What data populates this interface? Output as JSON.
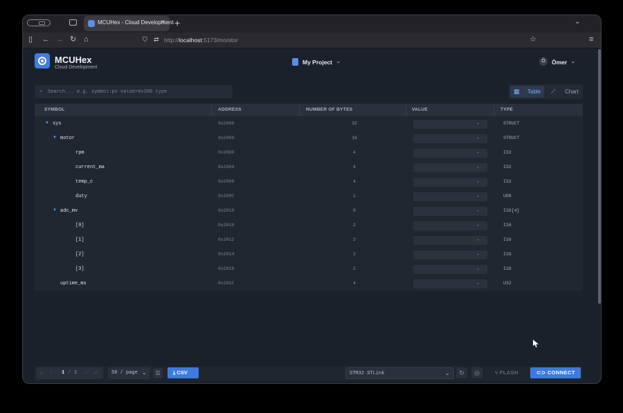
{
  "browser": {
    "tab_title": "MCUHex - Cloud Development",
    "url_prefix": "http://",
    "url_host": "localhost",
    "url_path": ":5173/monitor"
  },
  "app": {
    "name": "MCUHex",
    "subtitle": "Cloud Development",
    "project": "My Project",
    "user_initial": "Ö",
    "user_name": "Ömer"
  },
  "search": {
    "placeholder": "Search... e.g. symbol:px value>0x200 type"
  },
  "view_toggle": {
    "table_label": "Table",
    "chart_label": "Chart",
    "active": "Table"
  },
  "columns": [
    "SYMBOL",
    "ADDRESS",
    "NUMBER OF BYTES",
    "VALUE",
    "TYPE"
  ],
  "rows": [
    {
      "symbol": "sys",
      "address": "0x2000",
      "bytes": "32",
      "value": "-",
      "type": "STRUCT",
      "depth": 0,
      "expanded": true
    },
    {
      "symbol": "motor",
      "address": "0x2000",
      "bytes": "16",
      "value": "-",
      "type": "STRUCT",
      "depth": 1,
      "expanded": true
    },
    {
      "symbol": "rpm",
      "address": "0x2000",
      "bytes": "4",
      "value": "-",
      "type": "I32",
      "depth": 2,
      "expanded": false
    },
    {
      "symbol": "current_ma",
      "address": "0x2004",
      "bytes": "4",
      "value": "-",
      "type": "I32",
      "depth": 2,
      "expanded": false
    },
    {
      "symbol": "temp_c",
      "address": "0x2008",
      "bytes": "4",
      "value": "-",
      "type": "I32",
      "depth": 2,
      "expanded": false
    },
    {
      "symbol": "duty",
      "address": "0x200C",
      "bytes": "1",
      "value": "-",
      "type": "U08",
      "depth": 2,
      "expanded": false
    },
    {
      "symbol": "adc_mv",
      "address": "0x2010",
      "bytes": "8",
      "value": "-",
      "type": "I16[4]",
      "depth": 1,
      "expanded": true
    },
    {
      "symbol": "[0]",
      "address": "0x2010",
      "bytes": "2",
      "value": "-",
      "type": "I16",
      "depth": 2,
      "expanded": false
    },
    {
      "symbol": "[1]",
      "address": "0x2012",
      "bytes": "2",
      "value": "-",
      "type": "I16",
      "depth": 2,
      "expanded": false
    },
    {
      "symbol": "[2]",
      "address": "0x2014",
      "bytes": "2",
      "value": "-",
      "type": "I16",
      "depth": 2,
      "expanded": false
    },
    {
      "symbol": "[3]",
      "address": "0x2016",
      "bytes": "2",
      "value": "-",
      "type": "I16",
      "depth": 2,
      "expanded": false
    },
    {
      "symbol": "uptime_ms",
      "address": "0x201C",
      "bytes": "4",
      "value": "-",
      "type": "U32",
      "depth": 1,
      "expanded": false
    }
  ],
  "footer": {
    "page_current": "1",
    "page_sep": "/",
    "page_total": "1",
    "per_page": "50 / page",
    "csv_label": "CSV",
    "probe": "STM32 STLink",
    "flash_label": "FLASH",
    "connect_label": "CONNECT"
  },
  "colors": {
    "accent": "#3b7be0",
    "background": "#1b212b"
  }
}
